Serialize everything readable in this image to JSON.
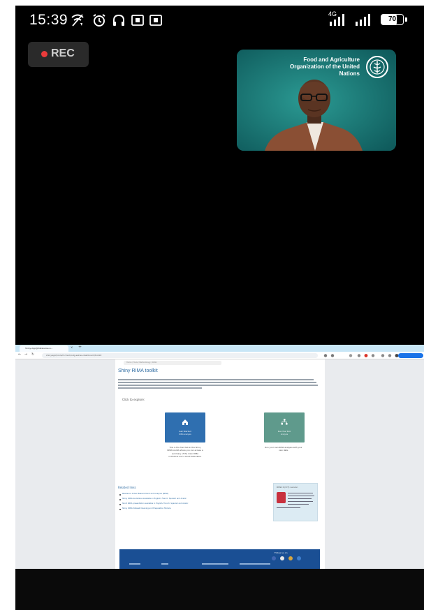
{
  "status_bar": {
    "time": "15:39",
    "network_label": "4G",
    "battery_percent": 70,
    "battery_text": "70",
    "icons": [
      "wifi-call-icon",
      "alarm-icon",
      "headphones-icon",
      "sim-1-icon",
      "sim-2-icon",
      "signal-4g-icon",
      "signal-icon",
      "battery-icon"
    ]
  },
  "recording": {
    "label": "REC",
    "dot_color": "#ea3b3b"
  },
  "speaker_tile": {
    "org_name": "Food and Agriculture Organization of the United Nations",
    "background_color": "#18706f",
    "icons": [
      "fao-logo-icon"
    ]
  },
  "shared_screen": {
    "browser": {
      "tab_title": "Shiny-App@Dataverse-A...",
      "url": "shiny.app/tools/mcheck/sdg-sakisa-dashboard/toolkit",
      "accent_color": "#1a73e8"
    },
    "page": {
      "breadcrumb": "Home / Tools / Methodology / RIMA",
      "title": "Shiny RIMA toolkit",
      "explore_label": "Click to explore:",
      "tiles": [
        {
          "title": "Get Started",
          "subtitle": "RIMA analysis",
          "color": "#2f6fb0",
          "icon": "home-icon",
          "description": "This is the front tab in the Shiny RIMA toolkit where you can access a summary of the main RIMA indicators and a small data table."
        },
        {
          "title": "Run the Tool",
          "subtitle": "Analysis",
          "color": "#5f9a8c",
          "icon": "hierarchy-icon",
          "description": "Run your own RIMA analysis with your own data."
        }
      ],
      "related_title": "Related links",
      "related_links": [
        "Resilience Index Measurement and Analysis (RIMA)",
        "Shiny RIMA Guidelines available in English, French, Spanish and Arabic",
        "Short RIMA presentation available in English, French, Spanish and Arabic",
        "Shiny RIMA Dataset Cleaning and Preparation Module"
      ],
      "sidebox": {
        "title": "RIMA II (ICT) version"
      },
      "footer": {
        "follow_label": "Follow us on",
        "color": "#1a4f94"
      }
    }
  }
}
